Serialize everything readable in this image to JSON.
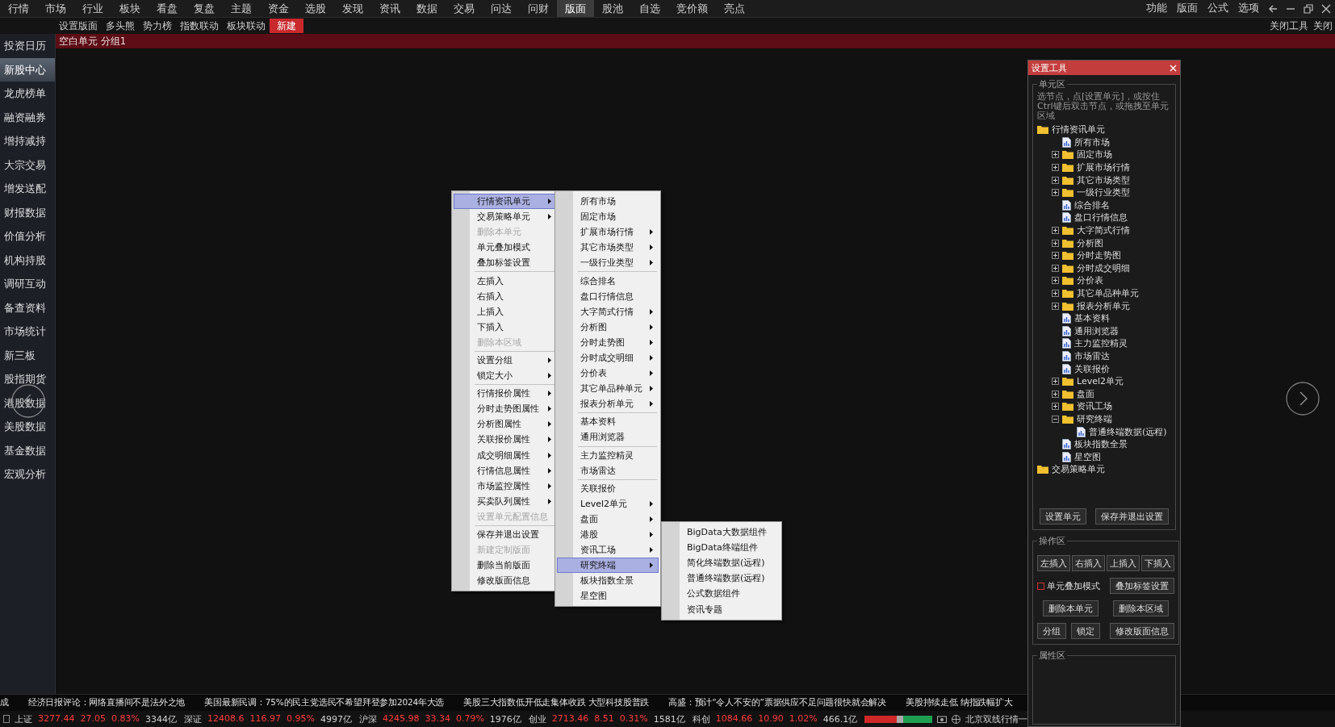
{
  "menubar": {
    "items": [
      {
        "label": "行情",
        "selected": false
      },
      {
        "label": "市场",
        "selected": false
      },
      {
        "label": "行业",
        "selected": false
      },
      {
        "label": "板块",
        "selected": false
      },
      {
        "label": "看盘",
        "selected": false
      },
      {
        "label": "复盘",
        "selected": false
      },
      {
        "label": "主题",
        "selected": false
      },
      {
        "label": "资金",
        "selected": false
      },
      {
        "label": "选股",
        "selected": false
      },
      {
        "label": "发现",
        "selected": false
      },
      {
        "label": "资讯",
        "selected": false
      },
      {
        "label": "数据",
        "selected": false
      },
      {
        "label": "交易",
        "selected": false
      },
      {
        "label": "问达",
        "selected": false
      },
      {
        "label": "问财",
        "selected": false
      },
      {
        "label": "版面",
        "selected": true
      },
      {
        "label": "股池",
        "selected": false
      },
      {
        "label": "自选",
        "selected": false
      },
      {
        "label": "竞价额",
        "selected": false
      },
      {
        "label": "亮点",
        "selected": false
      }
    ],
    "right_items": [
      "功能",
      "版面",
      "公式",
      "选项"
    ]
  },
  "toolbar": {
    "items": [
      {
        "label": "设置版面",
        "selected": false
      },
      {
        "label": "多头熊",
        "selected": false
      },
      {
        "label": "势力榜",
        "selected": false
      },
      {
        "label": "指数联动",
        "selected": false
      },
      {
        "label": "板块联动",
        "selected": false
      },
      {
        "label": "新建",
        "selected": true
      }
    ],
    "right_items": [
      "关闭工具",
      "关闭"
    ]
  },
  "layout_bar": {
    "title": "空白单元 分组1"
  },
  "sidebar": {
    "items": [
      {
        "label": "投资日历",
        "selected": false
      },
      {
        "label": "新股中心",
        "selected": true
      },
      {
        "label": "龙虎榜单",
        "selected": false
      },
      {
        "label": "融资融券",
        "selected": false
      },
      {
        "label": "增持减持",
        "selected": false
      },
      {
        "label": "大宗交易",
        "selected": false
      },
      {
        "label": "增发送配",
        "selected": false
      },
      {
        "label": "财报数据",
        "selected": false
      },
      {
        "label": "价值分析",
        "selected": false
      },
      {
        "label": "机构持股",
        "selected": false
      },
      {
        "label": "调研互动",
        "selected": false
      },
      {
        "label": "备查资料",
        "selected": false
      },
      {
        "label": "市场统计",
        "selected": false
      },
      {
        "label": "新三板",
        "selected": false
      },
      {
        "label": "股指期货",
        "selected": false
      },
      {
        "label": "港股数据",
        "selected": false
      },
      {
        "label": "美股数据",
        "selected": false
      },
      {
        "label": "基金数据",
        "selected": false
      },
      {
        "label": "宏观分析",
        "selected": false
      }
    ]
  },
  "context_menus": [
    {
      "items": [
        {
          "kind": "item",
          "label": "行情资讯单元",
          "submenu": true,
          "disabled": false,
          "selected": true
        },
        {
          "kind": "item",
          "label": "交易策略单元",
          "submenu": true,
          "disabled": false,
          "selected": false
        },
        {
          "kind": "item",
          "label": "删除本单元",
          "submenu": false,
          "disabled": true,
          "selected": false
        },
        {
          "kind": "item",
          "label": "单元叠加模式",
          "submenu": false,
          "disabled": false,
          "selected": false
        },
        {
          "kind": "item",
          "label": "叠加标签设置",
          "submenu": false,
          "disabled": false,
          "selected": false
        },
        {
          "kind": "separator"
        },
        {
          "kind": "item",
          "label": "左插入",
          "submenu": false,
          "disabled": false,
          "selected": false
        },
        {
          "kind": "item",
          "label": "右插入",
          "submenu": false,
          "disabled": false,
          "selected": false
        },
        {
          "kind": "item",
          "label": "上插入",
          "submenu": false,
          "disabled": false,
          "selected": false
        },
        {
          "kind": "item",
          "label": "下插入",
          "submenu": false,
          "disabled": false,
          "selected": false
        },
        {
          "kind": "item",
          "label": "删除本区域",
          "submenu": false,
          "disabled": true,
          "selected": false
        },
        {
          "kind": "separator"
        },
        {
          "kind": "item",
          "label": "设置分组",
          "submenu": true,
          "disabled": false,
          "selected": false
        },
        {
          "kind": "item",
          "label": "锁定大小",
          "submenu": true,
          "disabled": false,
          "selected": false
        },
        {
          "kind": "separator"
        },
        {
          "kind": "item",
          "label": "行情报价属性",
          "submenu": true,
          "disabled": false,
          "selected": false
        },
        {
          "kind": "item",
          "label": "分时走势图属性",
          "submenu": true,
          "disabled": false,
          "selected": false
        },
        {
          "kind": "item",
          "label": "分析图属性",
          "submenu": true,
          "disabled": false,
          "selected": false
        },
        {
          "kind": "item",
          "label": "关联报价属性",
          "submenu": true,
          "disabled": false,
          "selected": false
        },
        {
          "kind": "item",
          "label": "成交明细属性",
          "submenu": true,
          "disabled": false,
          "selected": false
        },
        {
          "kind": "item",
          "label": "行情信息属性",
          "submenu": true,
          "disabled": false,
          "selected": false
        },
        {
          "kind": "item",
          "label": "市场监控属性",
          "submenu": true,
          "disabled": false,
          "selected": false
        },
        {
          "kind": "item",
          "label": "买卖队列属性",
          "submenu": true,
          "disabled": false,
          "selected": false
        },
        {
          "kind": "item",
          "label": "设置单元配置信息",
          "submenu": false,
          "disabled": true,
          "selected": false
        },
        {
          "kind": "separator"
        },
        {
          "kind": "item",
          "label": "保存并退出设置",
          "submenu": false,
          "disabled": false,
          "selected": false
        },
        {
          "kind": "item",
          "label": "新建定制版面",
          "submenu": false,
          "disabled": true,
          "selected": false
        },
        {
          "kind": "item",
          "label": "删除当前版面",
          "submenu": false,
          "disabled": false,
          "selected": false
        },
        {
          "kind": "item",
          "label": "修改版面信息",
          "submenu": false,
          "disabled": false,
          "selected": false
        }
      ]
    },
    {
      "items": [
        {
          "kind": "item",
          "label": "所有市场",
          "submenu": false,
          "disabled": false,
          "selected": false
        },
        {
          "kind": "item",
          "label": "固定市场",
          "submenu": false,
          "disabled": false,
          "selected": false
        },
        {
          "kind": "item",
          "label": "扩展市场行情",
          "submenu": true,
          "disabled": false,
          "selected": false
        },
        {
          "kind": "item",
          "label": "其它市场类型",
          "submenu": true,
          "disabled": false,
          "selected": false
        },
        {
          "kind": "item",
          "label": "一级行业类型",
          "submenu": true,
          "disabled": false,
          "selected": false
        },
        {
          "kind": "separator"
        },
        {
          "kind": "item",
          "label": "综合排名",
          "submenu": false,
          "disabled": false,
          "selected": false
        },
        {
          "kind": "item",
          "label": "盘口行情信息",
          "submenu": false,
          "disabled": false,
          "selected": false
        },
        {
          "kind": "item",
          "label": "大字简式行情",
          "submenu": true,
          "disabled": false,
          "selected": false
        },
        {
          "kind": "item",
          "label": "分析图",
          "submenu": true,
          "disabled": false,
          "selected": false
        },
        {
          "kind": "item",
          "label": "分时走势图",
          "submenu": true,
          "disabled": false,
          "selected": false
        },
        {
          "kind": "item",
          "label": "分时成交明细",
          "submenu": true,
          "disabled": false,
          "selected": false
        },
        {
          "kind": "item",
          "label": "分价表",
          "submenu": true,
          "disabled": false,
          "selected": false
        },
        {
          "kind": "item",
          "label": "其它单品种单元",
          "submenu": true,
          "disabled": false,
          "selected": false
        },
        {
          "kind": "item",
          "label": "报表分析单元",
          "submenu": true,
          "disabled": false,
          "selected": false
        },
        {
          "kind": "separator"
        },
        {
          "kind": "item",
          "label": "基本资料",
          "submenu": false,
          "disabled": false,
          "selected": false
        },
        {
          "kind": "item",
          "label": "通用浏览器",
          "submenu": false,
          "disabled": false,
          "selected": false
        },
        {
          "kind": "separator"
        },
        {
          "kind": "item",
          "label": "主力监控精灵",
          "submenu": false,
          "disabled": false,
          "selected": false
        },
        {
          "kind": "item",
          "label": "市场雷达",
          "submenu": false,
          "disabled": false,
          "selected": false
        },
        {
          "kind": "separator"
        },
        {
          "kind": "item",
          "label": "关联报价",
          "submenu": false,
          "disabled": false,
          "selected": false
        },
        {
          "kind": "item",
          "label": "Level2单元",
          "submenu": true,
          "disabled": false,
          "selected": false
        },
        {
          "kind": "item",
          "label": "盘面",
          "submenu": true,
          "disabled": false,
          "selected": false
        },
        {
          "kind": "item",
          "label": "港股",
          "submenu": true,
          "disabled": false,
          "selected": false
        },
        {
          "kind": "item",
          "label": "资讯工场",
          "submenu": true,
          "disabled": false,
          "selected": false
        },
        {
          "kind": "item",
          "label": "研究终端",
          "submenu": true,
          "disabled": false,
          "selected": true
        },
        {
          "kind": "item",
          "label": "板块指数全景",
          "submenu": false,
          "disabled": false,
          "selected": false
        },
        {
          "kind": "item",
          "label": "星空图",
          "submenu": false,
          "disabled": false,
          "selected": false
        }
      ]
    },
    {
      "items": [
        {
          "kind": "item",
          "label": "BigData大数据组件",
          "submenu": false,
          "disabled": false,
          "selected": false
        },
        {
          "kind": "item",
          "label": "BigData终端组件",
          "submenu": false,
          "disabled": false,
          "selected": false
        },
        {
          "kind": "item",
          "label": "简化终端数据(远程)",
          "submenu": false,
          "disabled": false,
          "selected": false
        },
        {
          "kind": "item",
          "label": "普通终端数据(远程)",
          "submenu": false,
          "disabled": false,
          "selected": false
        },
        {
          "kind": "item",
          "label": "公式数据组件",
          "submenu": false,
          "disabled": false,
          "selected": false
        },
        {
          "kind": "item",
          "label": "资讯专题",
          "submenu": false,
          "disabled": false,
          "selected": false
        }
      ]
    }
  ],
  "settings_tool": {
    "title": "设置工具",
    "unit_section": {
      "title": "单元区",
      "hint": "选节点，点[设置单元]，或按住Ctrl键后双击节点，或拖拽至单元区域",
      "tree": [
        {
          "label": "行情资讯单元",
          "kind": "folder",
          "children": [
            {
              "label": "所有市场",
              "kind": "doc"
            },
            {
              "label": "固定市场",
              "kind": "folder",
              "expanded": false
            },
            {
              "label": "扩展市场行情",
              "kind": "folder",
              "expanded": false
            },
            {
              "label": "其它市场类型",
              "kind": "folder",
              "expanded": false
            },
            {
              "label": "一级行业类型",
              "kind": "folder",
              "expanded": false
            },
            {
              "label": "综合排名",
              "kind": "doc"
            },
            {
              "label": "盘口行情信息",
              "kind": "doc"
            },
            {
              "label": "大字简式行情",
              "kind": "folder",
              "expanded": false
            },
            {
              "label": "分析图",
              "kind": "folder",
              "expanded": false
            },
            {
              "label": "分时走势图",
              "kind": "folder",
              "expanded": false
            },
            {
              "label": "分时成交明细",
              "kind": "folder",
              "expanded": false
            },
            {
              "label": "分价表",
              "kind": "folder",
              "expanded": false
            },
            {
              "label": "其它单品种单元",
              "kind": "folder",
              "expanded": false
            },
            {
              "label": "报表分析单元",
              "kind": "folder",
              "expanded": false
            },
            {
              "label": "基本资料",
              "kind": "doc"
            },
            {
              "label": "通用浏览器",
              "kind": "doc"
            },
            {
              "label": "主力监控精灵",
              "kind": "doc"
            },
            {
              "label": "市场雷达",
              "kind": "doc"
            },
            {
              "label": "关联报价",
              "kind": "doc"
            },
            {
              "label": "Level2单元",
              "kind": "folder",
              "expanded": false
            },
            {
              "label": "盘面",
              "kind": "folder",
              "expanded": false
            },
            {
              "label": "资讯工场",
              "kind": "folder",
              "expanded": false
            },
            {
              "label": "研究终端",
              "kind": "folder",
              "expanded": true,
              "children": [
                {
                  "label": "普通终端数据(远程)",
                  "kind": "doc"
                }
              ]
            },
            {
              "label": "板块指数全景",
              "kind": "doc"
            },
            {
              "label": "星空图",
              "kind": "doc"
            }
          ]
        },
        {
          "label": "交易策略单元",
          "kind": "folder"
        }
      ],
      "buttons": [
        "设置单元",
        "保存并退出设置"
      ]
    },
    "operation_section": {
      "title": "操作区",
      "insert_buttons": [
        "左插入",
        "右插入",
        "上插入",
        "下插入"
      ],
      "overlay_mode": {
        "label": "单元叠加模式",
        "checked": false
      },
      "overlay_button": "叠加标签设置",
      "delete_buttons": [
        "删除本单元",
        "删除本区域"
      ],
      "small_buttons": [
        "分组",
        "锁定"
      ],
      "edit_button": "修改版面信息"
    },
    "property_section": {
      "title": "属性区"
    }
  },
  "news_ticker": [
    "成",
    "经济日报评论：网络直播间不是法外之地",
    "美国最新民调：75%的民主党选民不希望拜登参加2024年大选",
    "美股三大指数低开低走集体收跌 大型科技股普跌",
    "高盛：预计“令人不安的”票据供应不足问题很快就会解决",
    "美股持续走低 纳指跌幅扩大"
  ],
  "indices": [
    {
      "name": "上证",
      "value": "3277.44",
      "change": "27.05",
      "percent": "0.83%",
      "amount": "3344亿",
      "up": true
    },
    {
      "name": "深证",
      "value": "12408.6",
      "change": "116.97",
      "percent": "0.95%",
      "amount": "4997亿",
      "up": true
    },
    {
      "name": "沪深",
      "value": "4245.98",
      "change": "33.34",
      "percent": "0.79%",
      "amount": "1976亿",
      "up": true
    },
    {
      "name": "创业",
      "value": "2713.46",
      "change": "8.51",
      "percent": "0.31%",
      "amount": "1581亿",
      "up": true
    },
    {
      "name": "科创",
      "value": "1084.66",
      "change": "10.90",
      "percent": "1.02%",
      "amount": "466.1亿",
      "up": true
    }
  ],
  "connection": "北京双线行情一"
}
